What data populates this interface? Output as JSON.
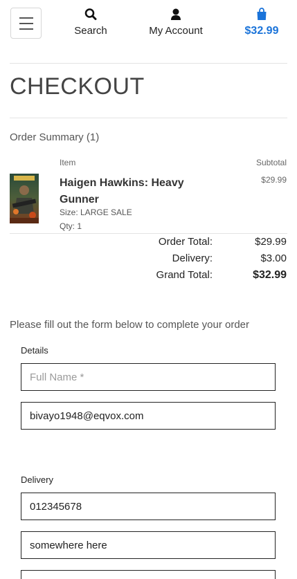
{
  "header": {
    "search_label": "Search",
    "account_label": "My Account",
    "bag_total": "$32.99",
    "icons": {
      "menu": "hamburger-menu-icon",
      "search": "search-icon",
      "account": "user-icon",
      "bag": "shopping-bag-icon"
    },
    "accent_color": "#1a73d9"
  },
  "page": {
    "title": "CHECKOUT"
  },
  "summary": {
    "heading": "Order Summary (1)",
    "col_item": "Item",
    "col_subtotal": "Subtotal",
    "items": [
      {
        "name": "Haigen Hawkins: Heavy Gunner",
        "size": "Size: LARGE SALE",
        "qty": "Qty: 1",
        "subtotal": "$29.99"
      }
    ],
    "order_total_label": "Order Total:",
    "order_total": "$29.99",
    "delivery_label": "Delivery:",
    "delivery": "$3.00",
    "grand_total_label": "Grand Total:",
    "grand_total": "$32.99"
  },
  "form": {
    "instructions": "Please fill out the form below to complete your order",
    "details_legend": "Details",
    "full_name_placeholder": "Full Name *",
    "full_name_value": "",
    "email_value": "bivayo1948@eqvox.com",
    "delivery_legend": "Delivery",
    "phone_value": "012345678",
    "address_value": "somewhere here",
    "next_value": ""
  }
}
